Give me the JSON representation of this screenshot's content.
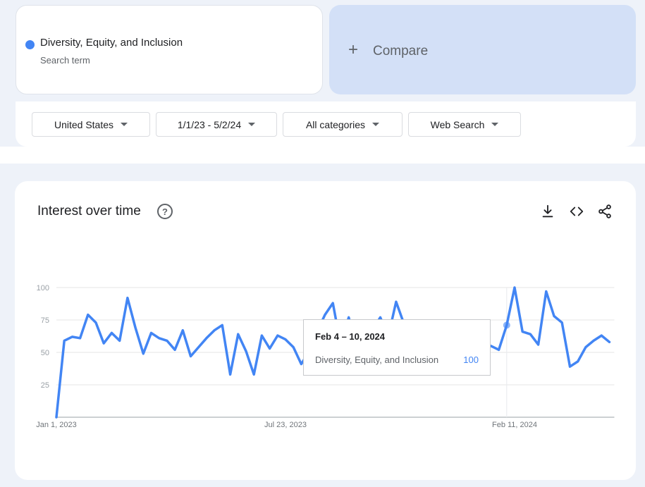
{
  "search_term": {
    "name": "Diversity, Equity, and Inclusion",
    "subtitle": "Search term",
    "color": "#4285f4"
  },
  "compare": {
    "label": "Compare",
    "icon": "plus-icon"
  },
  "filters": [
    {
      "label": "United States",
      "icon": "caret-down-icon"
    },
    {
      "label": "1/1/23 - 5/2/24",
      "icon": "caret-down-icon"
    },
    {
      "label": "All categories",
      "icon": "caret-down-icon"
    },
    {
      "label": "Web Search",
      "icon": "caret-down-icon"
    }
  ],
  "chart": {
    "title": "Interest over time",
    "help_icon": "help-circle-icon",
    "actions": [
      "download-icon",
      "embed-code-icon",
      "share-icon"
    ]
  },
  "tooltip": {
    "date": "Feb 4 – 10, 2024",
    "series": "Diversity, Equity, and Inclusion",
    "value": "100"
  },
  "chart_data": {
    "type": "line",
    "ylim": [
      0,
      100
    ],
    "yticks": [
      25,
      50,
      75,
      100
    ],
    "x_tick_labels": [
      "Jan 1, 2023",
      "Jul 23, 2023",
      "Feb 11, 2024"
    ],
    "x_tick_weeks": [
      0,
      29,
      58
    ],
    "grid": true,
    "line_color": "#4285f4",
    "highlight_week": 57,
    "series": [
      {
        "values": [
          0,
          59,
          62,
          61,
          79,
          73,
          57,
          65,
          59,
          92,
          69,
          49,
          65,
          61,
          59,
          52,
          67,
          47,
          54,
          61,
          67,
          71,
          33,
          64,
          51,
          33,
          63,
          53,
          63,
          60,
          54,
          41,
          51,
          66,
          79,
          88,
          55,
          77,
          53,
          63,
          67,
          77,
          62,
          89,
          72,
          52,
          72,
          48,
          44,
          55,
          53,
          37,
          35,
          38,
          51,
          55,
          52,
          71,
          100,
          66,
          64,
          56,
          97,
          78,
          73,
          39,
          43,
          54,
          59,
          63,
          58
        ]
      }
    ]
  }
}
